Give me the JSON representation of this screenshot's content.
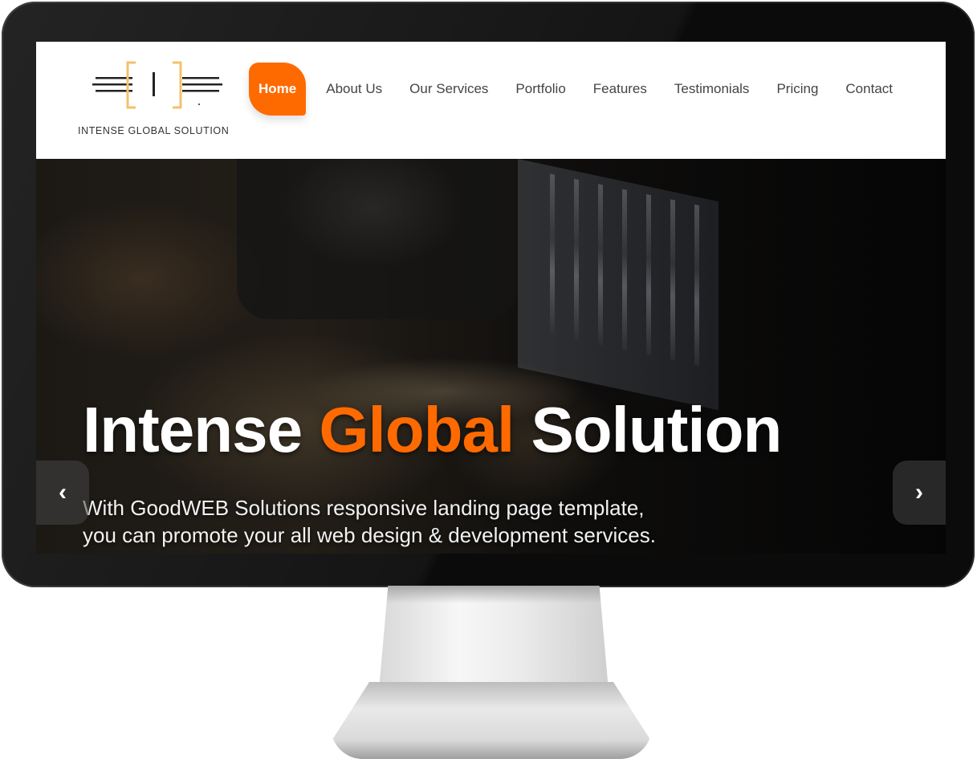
{
  "brand": {
    "logo_text": "INTENSE GLOBAL SOLUTION",
    "logo_letter": "I",
    "accent_color": "#ff6a00"
  },
  "nav": {
    "items": [
      {
        "label": "Home",
        "active": true
      },
      {
        "label": "About Us"
      },
      {
        "label": "Our Services"
      },
      {
        "label": "Portfolio"
      },
      {
        "label": "Features"
      },
      {
        "label": "Testimonials"
      },
      {
        "label": "Pricing"
      },
      {
        "label": "Contact"
      }
    ]
  },
  "hero": {
    "title_part1": "Intense ",
    "title_accent": "Global",
    "title_part2": " Solution",
    "subtitle_line1": "With GoodWEB Solutions responsive landing page template,",
    "subtitle_line2": "you can promote your all web design & development services.",
    "prev_icon": "chevron-left-icon",
    "next_icon": "chevron-right-icon",
    "prev_glyph": "‹",
    "next_glyph": "›"
  }
}
